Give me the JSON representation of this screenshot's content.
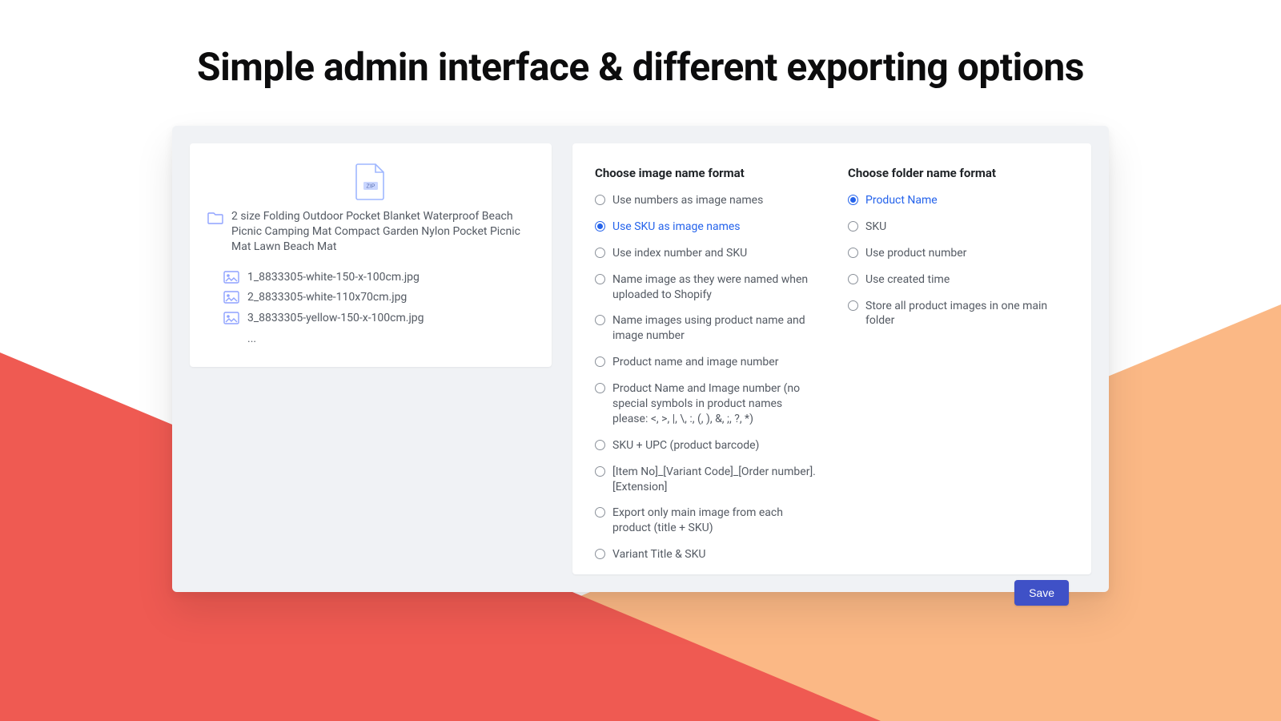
{
  "title": "Simple admin interface & different exporting options",
  "preview": {
    "zip_label": "ZIP",
    "folder_name": "2 size Folding Outdoor Pocket Blanket Waterproof Beach Picnic Camping Mat Compact Garden Nylon Pocket Picnic Mat Lawn Beach Mat",
    "files": [
      "1_8833305-white-150-x-100cm.jpg",
      "2_8833305-white-110x70cm.jpg",
      "3_8833305-yellow-150-x-100cm.jpg"
    ],
    "more_indicator": "..."
  },
  "image_format": {
    "heading": "Choose image name format",
    "selected_index": 1,
    "options": [
      "Use numbers as image names",
      "Use SKU as image names",
      "Use index number and SKU",
      "Name image as they were named when uploaded to Shopify",
      "Name images using product name and image number",
      "Product name and image number",
      "Product Name and Image number (no special symbols in product names please: <, >, |, \\, :, (, ), &, ;, ?, *)",
      "SKU + UPC (product barcode)",
      "[Item No]_[Variant Code]_[Order number].[Extension]",
      "Export only main image from each product (title + SKU)",
      "Variant Title & SKU"
    ]
  },
  "folder_format": {
    "heading": "Choose folder name format",
    "selected_index": 0,
    "options": [
      "Product Name",
      "SKU",
      "Use product number",
      "Use created time",
      "Store all product images in one main folder"
    ]
  },
  "save_label": "Save",
  "colors": {
    "accent": "#2563eb",
    "save_btn": "#3f51c7",
    "text_muted": "#545a63",
    "bg_panel": "#f0f2f5",
    "tri_left": "#ef5a52",
    "tri_right": "#fbb885"
  }
}
